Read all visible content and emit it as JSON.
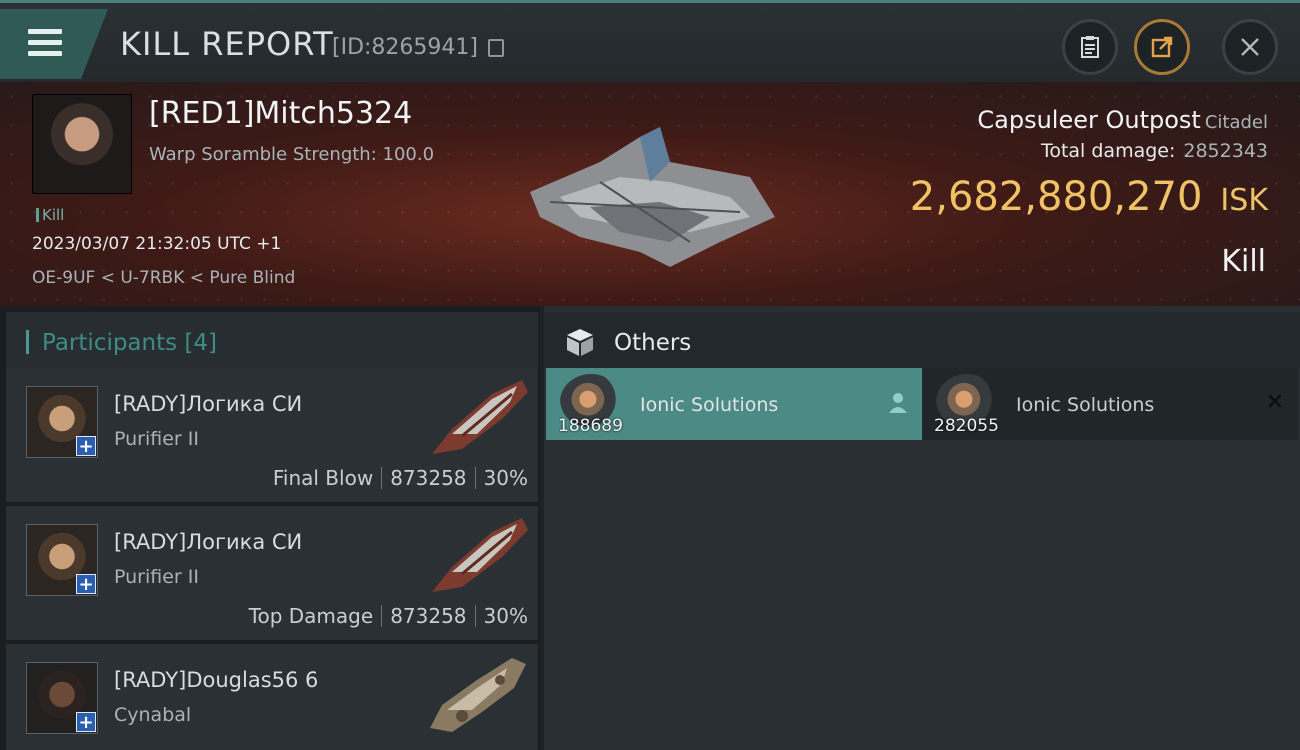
{
  "header": {
    "title": "KILL REPORT",
    "id_text": "[ID:8265941]"
  },
  "icons": {
    "menu": "menu-icon",
    "copy": "copy-icon",
    "clipboard": "clipboard-icon",
    "share": "share-icon",
    "close": "close-icon"
  },
  "victim": {
    "name": "[RED1]Mitch5324",
    "subtitle": "Warp Soramble Strength: 100.0",
    "tag": "Kill",
    "timestamp": "2023/03/07 21:32:05 UTC +1",
    "location": "OE-9UF < U-7RBK < Pure Blind"
  },
  "target": {
    "name": "Capsuleer Outpost",
    "type": "Citadel",
    "total_damage_label": "Total damage:",
    "total_damage": "2852343",
    "isk_value": "2,682,880,270",
    "isk_unit": "ISK",
    "result": "Kill"
  },
  "participants": {
    "label": "Participants",
    "count": "[4]",
    "rows": [
      {
        "name": "[RADY]Логика СИ",
        "ship": "Purifier II",
        "role": "Final Blow",
        "damage": "873258",
        "percent": "30%"
      },
      {
        "name": "[RADY]Логика СИ",
        "ship": "Purifier II",
        "role": "Top Damage",
        "damage": "873258",
        "percent": "30%"
      },
      {
        "name": "[RADY]Douglas56 6",
        "ship": "Cynabal"
      }
    ]
  },
  "others": {
    "label": "Others",
    "items": [
      {
        "name": "Ionic Solutions",
        "qty": "188689"
      },
      {
        "name": "Ionic Solutions",
        "qty": "282055"
      }
    ]
  },
  "colors": {
    "accent_teal": "#4c8a85",
    "isk_gold": "#f0c266",
    "background": "#1e2225"
  }
}
